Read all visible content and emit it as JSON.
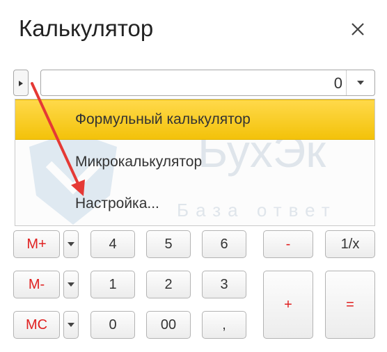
{
  "window": {
    "title": "Калькулятор",
    "close_icon": "close-icon"
  },
  "display": {
    "value": "0",
    "expander_icon": "triangle-right-icon",
    "dropdown_icon": "chevron-down-icon"
  },
  "menu": {
    "items": [
      {
        "label": "Формульный калькулятор",
        "selected": true
      },
      {
        "label": "Микрокалькулятор",
        "selected": false
      },
      {
        "label": "Настройка...",
        "selected": false
      }
    ],
    "watermark": {
      "text": "БухЭк",
      "sub": "База ответ"
    }
  },
  "keypad": {
    "m_plus": "M+",
    "m_minus": "M-",
    "mc": "MC",
    "digits": [
      "4",
      "5",
      "6",
      "1",
      "2",
      "3",
      "0",
      "00",
      ","
    ],
    "minus": "-",
    "reciprocal": "1/x",
    "plus": "+",
    "equals": "="
  },
  "colors": {
    "accent_red": "#e02020",
    "selected_yellow": "#f5c518",
    "annotation_arrow": "#e53935"
  }
}
